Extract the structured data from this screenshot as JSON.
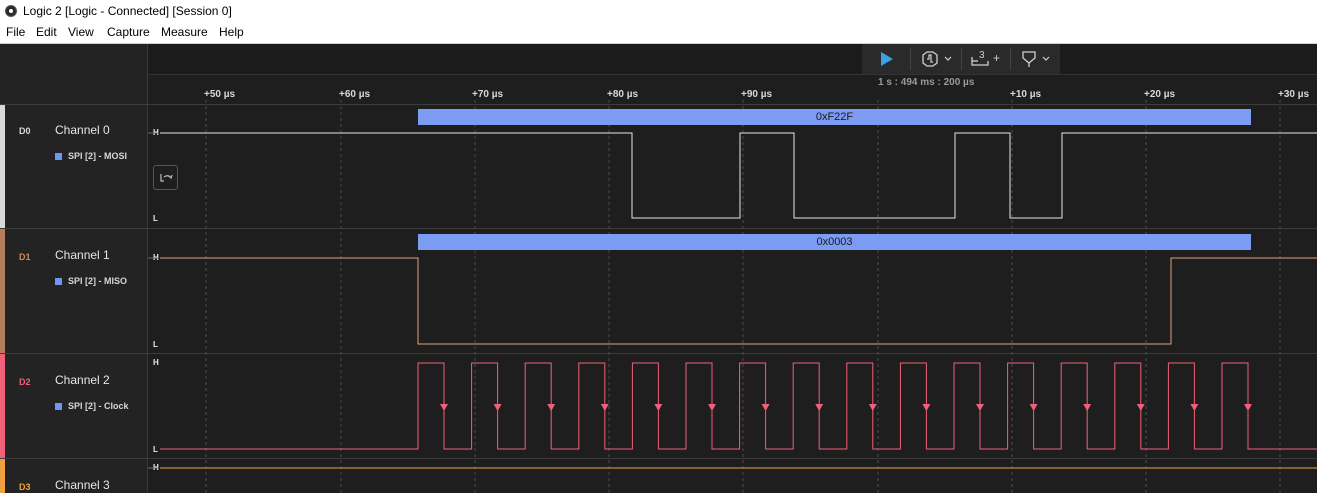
{
  "window": {
    "title": "Logic 2 [Logic - Connected] [Session 0]"
  },
  "menu": {
    "items": [
      "File",
      "Edit",
      "View",
      "Capture",
      "Measure",
      "Help"
    ]
  },
  "toolbar": {
    "play_icon": "play-icon",
    "trigger_icon": "trigger-icon",
    "measure_icon": "measure-icon",
    "measure_badge": "3",
    "measure_plus": "+",
    "marker_icon": "marker-icon"
  },
  "timeline": {
    "zoom_text": "1 s : 494 ms : 200 µs",
    "ticks": [
      "+50 µs",
      "+60 µs",
      "+70 µs",
      "+80 µs",
      "+90 µs",
      "+10 µs",
      "+20 µs",
      "+30 µs"
    ]
  },
  "channels": [
    {
      "id": "D0",
      "name": "Channel 0",
      "analyzer": "SPI [2] - MOSI",
      "color": "#d9d9d9",
      "decoded": "0xF22F",
      "high": "H",
      "low": "L"
    },
    {
      "id": "D1",
      "name": "Channel 1",
      "analyzer": "SPI [2] - MISO",
      "color": "#b47c5a",
      "decoded": "0x0003",
      "high": "H",
      "low": "L"
    },
    {
      "id": "D2",
      "name": "Channel 2",
      "analyzer": "SPI [2] - Clock",
      "color": "#f06078",
      "high": "H",
      "low": "L"
    },
    {
      "id": "D3",
      "name": "Channel 3",
      "color": "#f0a040",
      "high": "H"
    }
  ],
  "colors": {
    "analyzer_bubble": "#7c9cf4",
    "play": "#3ea0e6"
  }
}
